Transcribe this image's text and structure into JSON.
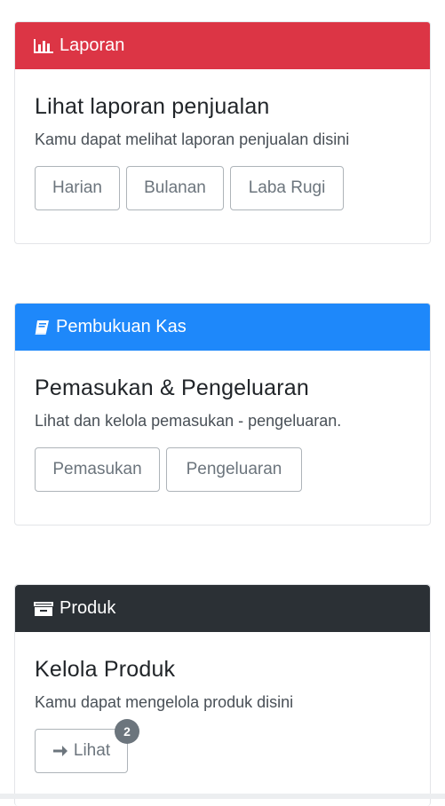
{
  "cards": [
    {
      "header": "Laporan",
      "header_color": "#dc3545",
      "icon": "bar-chart-icon",
      "title": "Lihat laporan penjualan",
      "text": "Kamu dapat melihat laporan penjualan disini",
      "buttons": [
        "Harian",
        "Bulanan",
        "Laba Rugi"
      ]
    },
    {
      "header": "Pembukuan Kas",
      "header_color": "#1e88fa",
      "icon": "book-icon",
      "title": "Pemasukan & Pengeluaran",
      "text": "Lihat dan kelola pemasukan - pengeluaran.",
      "buttons": [
        "Pemasukan",
        "Pengeluaran"
      ]
    },
    {
      "header": "Produk",
      "header_color": "#2b3035",
      "icon": "archive-icon",
      "title": "Kelola Produk",
      "text": "Kamu dapat mengelola produk disini",
      "buttons": [
        "Lihat"
      ],
      "badge": "2",
      "button_icon": "arrow-right-icon"
    }
  ]
}
